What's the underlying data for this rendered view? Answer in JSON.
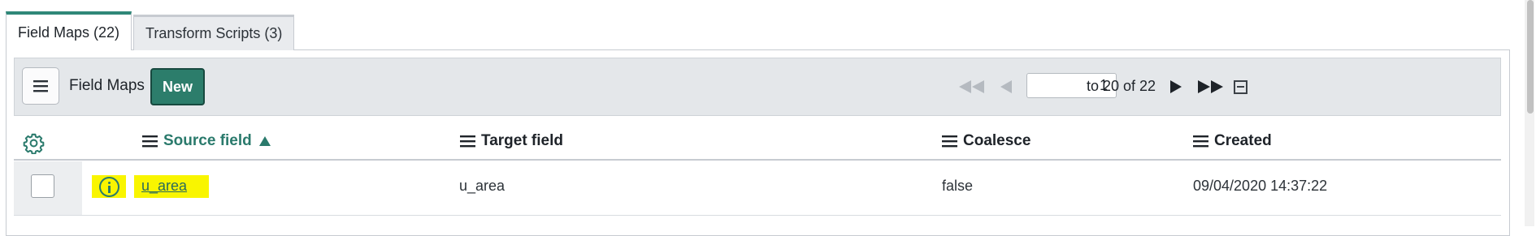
{
  "tabs": [
    {
      "label": "Field Maps (22)",
      "active": true
    },
    {
      "label": "Transform Scripts (3)",
      "active": false
    }
  ],
  "toolbar": {
    "menu_icon": "hamburger-icon",
    "list_title": "Field Maps",
    "new_label": "New",
    "pagination": {
      "first_icon": "first-page-icon",
      "prev_icon": "prev-page-icon",
      "page_value": "1",
      "range_text": "to 20 of 22",
      "next_icon": "next-page-icon",
      "last_icon": "last-page-icon"
    },
    "collapse_icon": "collapse-icon"
  },
  "table": {
    "settings_icon": "gear-icon",
    "columns": [
      {
        "label": "Source field",
        "sorted": "asc"
      },
      {
        "label": "Target field"
      },
      {
        "label": "Coalesce"
      },
      {
        "label": "Created"
      }
    ],
    "rows": [
      {
        "source_field": "u_area",
        "target_field": "u_area",
        "coalesce": "false",
        "created": "09/04/2020 14:37:22"
      }
    ]
  },
  "colors": {
    "accent": "#2c7d6b",
    "highlight": "#f9f500",
    "toolbar_bg": "#e4e7ea",
    "disabled_icon": "#b5bac0"
  }
}
